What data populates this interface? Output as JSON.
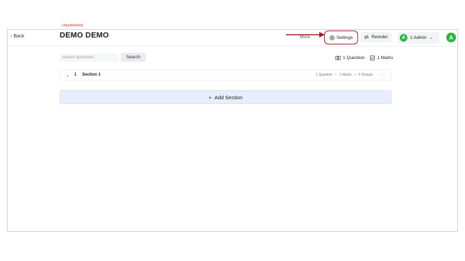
{
  "topbar": {
    "back_label": "Back",
    "admin_initial": "A",
    "admin_label": "1 Admin",
    "avatar_initial": "A"
  },
  "assessment": {
    "status": "Unpublished",
    "title": "DEMO DEMO"
  },
  "toolbar": {
    "more_label": "More",
    "settings_label": "Settings",
    "reorder_label": "Reorder"
  },
  "search": {
    "placeholder": "Search questions",
    "value": "",
    "button_label": "Search"
  },
  "stats": {
    "questions": "1 Question",
    "marks": "1 Marks"
  },
  "sections": [
    {
      "number": "1",
      "name": "Section 1",
      "questions": "1 Question",
      "marks": "1 Marks",
      "groups": "0 Groups",
      "separator": "•"
    }
  ],
  "add_section_label": "Add Section",
  "colors": {
    "accent": "#2fb344",
    "status": "#c0392b",
    "highlight": "#a31d2a",
    "add_bg": "#e8eefb"
  }
}
